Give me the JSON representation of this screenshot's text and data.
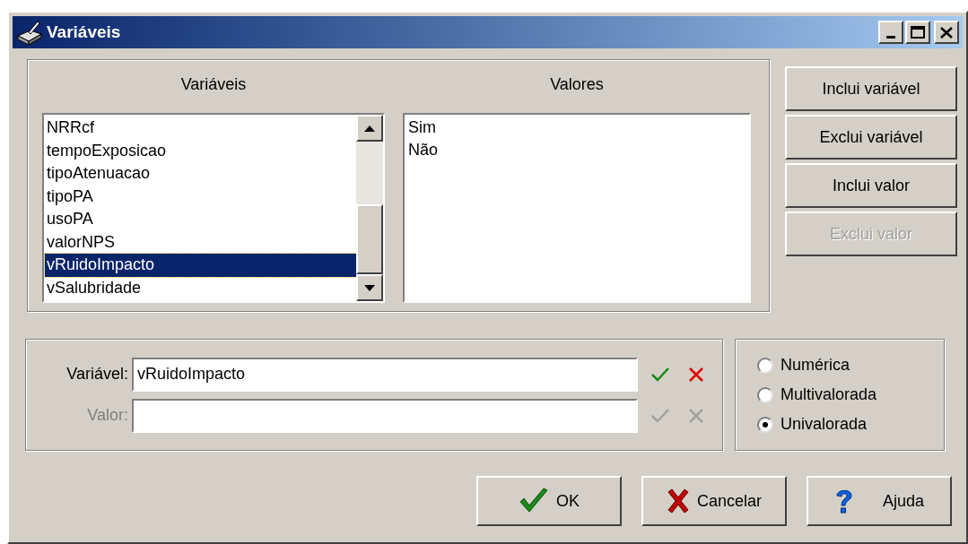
{
  "window": {
    "title": "Variáveis"
  },
  "variables_list": {
    "heading": "Variáveis",
    "items": [
      {
        "label": "NRRcf",
        "selected": false
      },
      {
        "label": "tempoExposicao",
        "selected": false
      },
      {
        "label": "tipoAtenuacao",
        "selected": false
      },
      {
        "label": "tipoPA",
        "selected": false
      },
      {
        "label": "usoPA",
        "selected": false
      },
      {
        "label": "valorNPS",
        "selected": false
      },
      {
        "label": "vRuidoImpacto",
        "selected": true
      },
      {
        "label": "vSalubridade",
        "selected": false
      }
    ]
  },
  "values_list": {
    "heading": "Valores",
    "items": [
      "Sim",
      "Não"
    ]
  },
  "side_buttons": [
    {
      "label": "Inclui variável",
      "disabled": false
    },
    {
      "label": "Exclui variável",
      "disabled": false
    },
    {
      "label": "Inclui valor",
      "disabled": false
    },
    {
      "label": "Exclui valor",
      "disabled": true
    }
  ],
  "fields": [
    {
      "label": "Variável:",
      "value": "vRuidoImpacto",
      "disabled": false
    },
    {
      "label": "Valor:",
      "disabled": true
    }
  ],
  "type_options": [
    {
      "label": "Numérica",
      "selected": false
    },
    {
      "label": "Multivalorada",
      "selected": false
    },
    {
      "label": "Univalorada",
      "selected": true
    }
  ],
  "buttons": [
    {
      "label": "OK",
      "kind": "ok"
    },
    {
      "label": "Cancelar",
      "kind": "cancel"
    },
    {
      "label": "Ajuda",
      "kind": "help"
    }
  ]
}
